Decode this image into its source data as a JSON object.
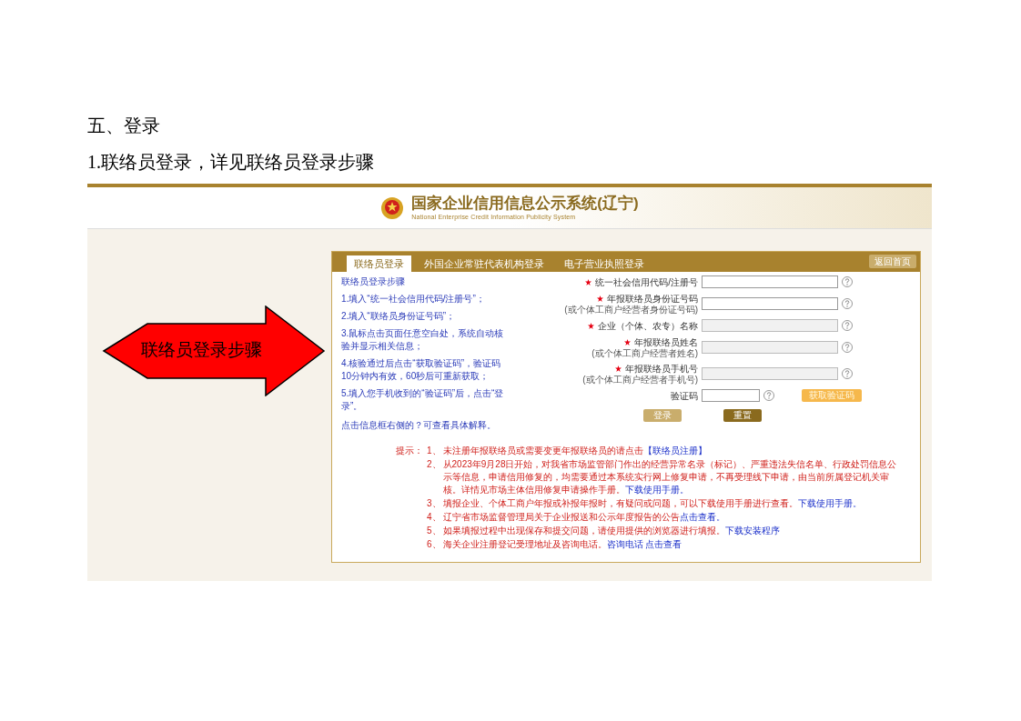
{
  "document": {
    "section_heading": "五、登录",
    "subheading": "1.联络员登录，详见联络员登录步骤"
  },
  "site_header": {
    "title": "国家企业信用信息公示系统(辽宁)",
    "subtitle": "National Enterprise Credit Information Publicity System"
  },
  "tabs": [
    {
      "label": "联络员登录",
      "selected": true
    },
    {
      "label": "外国企业常驻代表机构登录",
      "selected": false
    },
    {
      "label": "电子营业执照登录",
      "selected": false
    }
  ],
  "back_button": "返回首页",
  "steps": {
    "title": "联络员登录步骤",
    "items": [
      "1.填入“统一社会信用代码/注册号”；",
      "2.填入“联络员身份证号码”；",
      "3.鼠标点击页面任意空白处，系统自动核验并显示相关信息；",
      "4.核验通过后点击“获取验证码”，验证码10分钟内有效，60秒后可重新获取；",
      "5.填入您手机收到的“验证码”后，点击“登录”。"
    ],
    "footer": "点击信息框右侧的？可查看具体解释。"
  },
  "fields": [
    {
      "kind": "input",
      "label": "统一社会信用代码/注册号",
      "required": true,
      "disabled": false
    },
    {
      "kind": "input",
      "label": "年报联络员身份证号码",
      "sublabel": "(或个体工商户经营者身份证号码)",
      "required": true,
      "disabled": false
    },
    {
      "kind": "input",
      "label": "企业（个体、农专）名称",
      "required": true,
      "disabled": true
    },
    {
      "kind": "input",
      "label": "年报联络员姓名",
      "sublabel": "(或个体工商户经营者姓名)",
      "required": true,
      "disabled": true
    },
    {
      "kind": "input",
      "label": "年报联络员手机号",
      "sublabel": "(或个体工商户经营者手机号)",
      "required": true,
      "disabled": true
    },
    {
      "kind": "captcha",
      "label": "验证码",
      "required": false,
      "disabled": false,
      "button": "获取验证码"
    }
  ],
  "buttons": [
    "登录",
    "重置"
  ],
  "notes": {
    "label": "提示：",
    "items": [
      {
        "number": "1、",
        "parts": [
          {
            "kind": "text",
            "text": "未注册年报联络员或需要变更年报联络员的请点击"
          },
          {
            "kind": "link",
            "text": "【联络员注册】"
          }
        ]
      },
      {
        "number": "2、",
        "parts": [
          {
            "kind": "text",
            "text": "从2023年9月28日开始，对我省市场监管部门作出的经营异常名录（标记）、严重违法失信名单、行政处罚信息公示等信息，申请信用修复的，均需要通过本系统实行网上修复申请，不再受理线下申请，由当前所属登记机关审核。详情见市场主体信用修复申请操作手册。"
          },
          {
            "kind": "link",
            "text": "下载使用手册。"
          }
        ]
      },
      {
        "number": "3、",
        "parts": [
          {
            "kind": "text",
            "text": "填报企业、个体工商户年报或补报年报时，有疑问或问题，可以下载使用手册进行查看。"
          },
          {
            "kind": "link",
            "text": "下载使用手册。"
          }
        ]
      },
      {
        "number": "4、",
        "parts": [
          {
            "kind": "text",
            "text": "辽宁省市场监督管理局关于企业报送和公示年度报告的公告"
          },
          {
            "kind": "link",
            "text": "点击查看。"
          }
        ]
      },
      {
        "number": "5、",
        "parts": [
          {
            "kind": "text",
            "text": "如果填报过程中出现保存和提交问题，请使用提供的浏览器进行填报。"
          },
          {
            "kind": "link",
            "text": "下载安装程序"
          }
        ]
      },
      {
        "number": "6、",
        "parts": [
          {
            "kind": "text",
            "text": "海关企业注册登记受理地址及咨询电话。"
          },
          {
            "kind": "link",
            "text": "咨询电话 点击查看"
          }
        ]
      }
    ]
  },
  "callout": {
    "label": "联络员登录步骤"
  }
}
